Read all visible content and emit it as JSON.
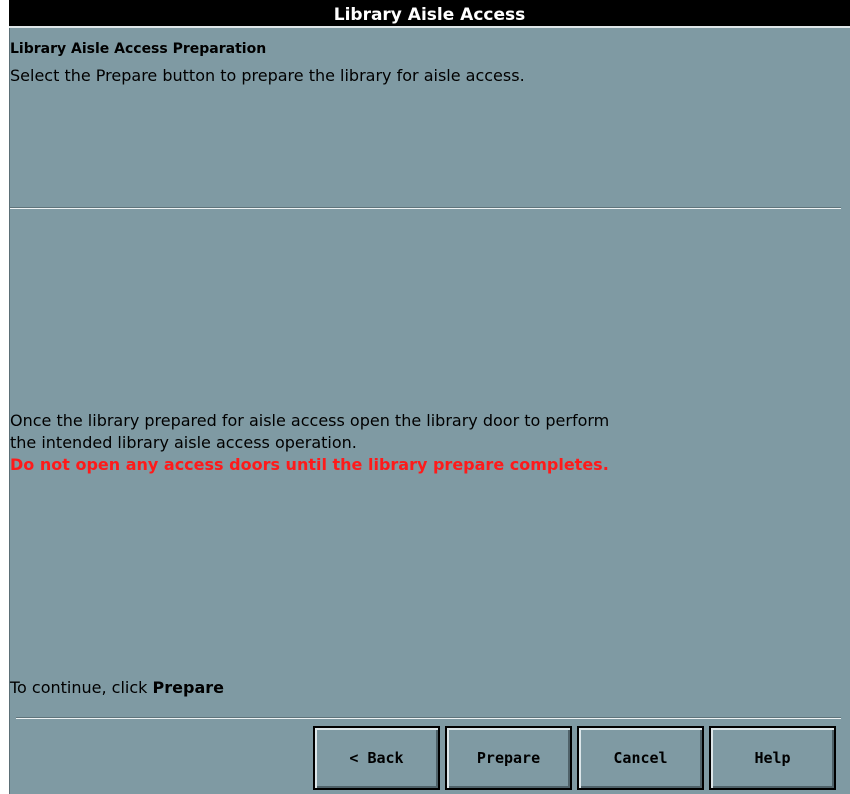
{
  "window": {
    "title": "Library Aisle Access"
  },
  "content": {
    "heading": "Library Aisle Access Preparation",
    "instruction": "Select the Prepare button to prepare the library for aisle access.",
    "info_line1": "Once the library prepared for aisle access open the library door to perform",
    "info_line2": "the intended library aisle access operation.",
    "warning": "Do not open any access doors until the library prepare completes.",
    "continue_prefix": "To continue, click ",
    "continue_action": "Prepare"
  },
  "buttons": {
    "back": "< Back",
    "prepare": "Prepare",
    "cancel": "Cancel",
    "help": "Help"
  },
  "colors": {
    "background": "#7f9aa3",
    "title_bar": "#000000",
    "warning_text": "#ff1a1a"
  }
}
